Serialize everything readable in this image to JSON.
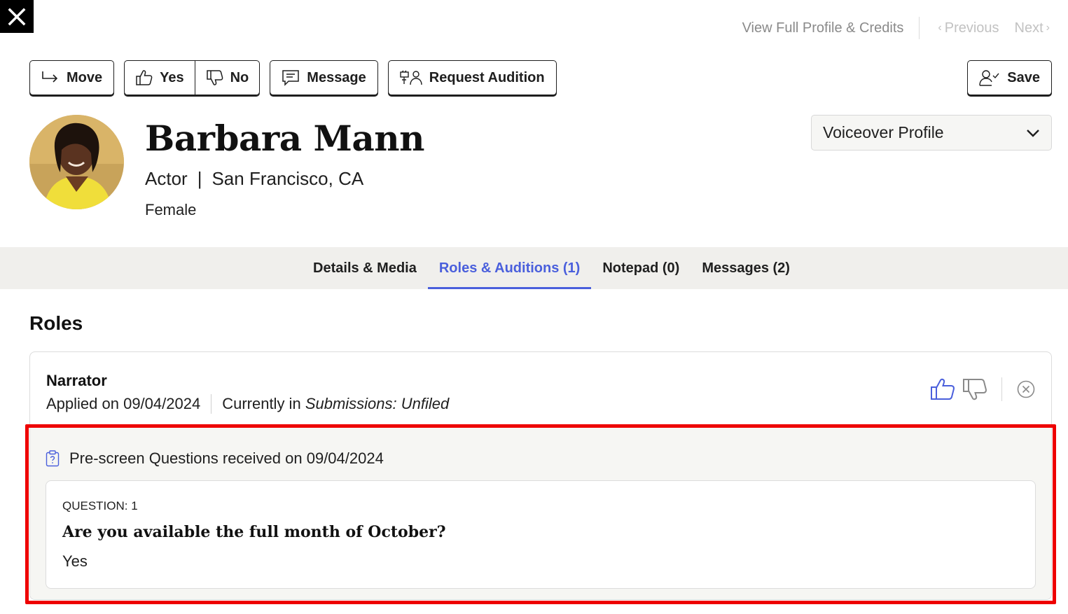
{
  "topnav": {
    "full_profile_label": "View Full Profile & Credits",
    "previous_label": "Previous",
    "next_label": "Next"
  },
  "actions": {
    "move_label": "Move",
    "yes_label": "Yes",
    "no_label": "No",
    "message_label": "Message",
    "request_audition_label": "Request Audition",
    "save_label": "Save"
  },
  "profile": {
    "name": "Barbara Mann",
    "type": "Actor",
    "separator": "|",
    "location": "San Francisco, CA",
    "gender": "Female",
    "profile_select": "Voiceover Profile"
  },
  "tabs": [
    {
      "label": "Details & Media",
      "active": false
    },
    {
      "label": "Roles & Auditions (1)",
      "active": true
    },
    {
      "label": "Notepad (0)",
      "active": false
    },
    {
      "label": "Messages (2)",
      "active": false
    }
  ],
  "roles": {
    "heading": "Roles",
    "items": [
      {
        "title": "Narrator",
        "applied": "Applied on 09/04/2024",
        "currently_prefix": "Currently in",
        "currently_location": "Submissions: Unfiled",
        "prescreen": {
          "header": "Pre-screen Questions received on 09/04/2024",
          "questions": [
            {
              "label": "QUESTION: 1",
              "text": "Are you available the full month of October?",
              "answer": "Yes"
            }
          ]
        }
      }
    ]
  },
  "colors": {
    "accent": "#4a5fdc",
    "highlight": "#ee0000",
    "tabbar_bg": "#f0efec",
    "prescreen_bg": "#f6f6f3"
  }
}
